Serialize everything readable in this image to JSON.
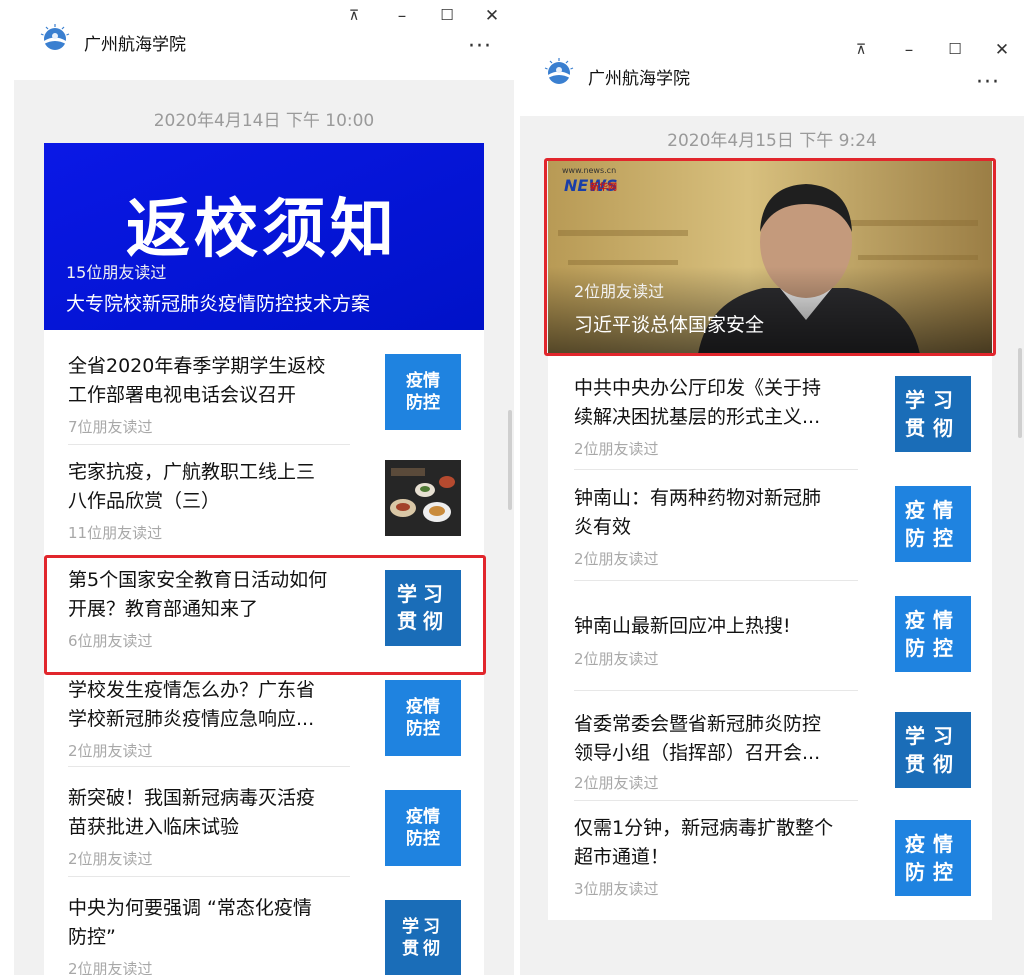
{
  "app": {
    "title": "广州航海学院",
    "pin_glyph": "⊼",
    "more_glyph": "···",
    "colors": {
      "badge_blue": "#1f83e0",
      "badge_dark": "#1a6db8",
      "highlight": "#e1262c",
      "chat_bg": "#f1f1f1"
    }
  },
  "left": {
    "timestamp": "2020年4月14日 下午 10:00",
    "cover": {
      "banner_text": "返校须知",
      "reads": "15位朋友读过",
      "title": "大专院校新冠肺炎疫情防控技术方案"
    },
    "items": [
      {
        "line1": "全省2020年春季学期学生返校",
        "line2": "工作部署电视电话会议召开",
        "reads": "7位朋友读过",
        "badge": [
          "疫情",
          "防控"
        ]
      },
      {
        "line1": "宅家抗疫，广航教职工线上三",
        "line2": "八作品欣赏（三）",
        "reads": "11位朋友读过"
      },
      {
        "line1": "第5个国家安全教育日活动如何",
        "line2": "开展？教育部通知来了",
        "reads": "6位朋友读过",
        "badge": [
          "学习",
          "贯彻"
        ]
      },
      {
        "line1": "学校发生疫情怎么办？广东省",
        "line2": "学校新冠肺炎疫情应急响应...",
        "reads": "2位朋友读过",
        "badge": [
          "疫情",
          "防控"
        ]
      },
      {
        "line1": "新突破！我国新冠病毒灭活疫",
        "line2": "苗获批进入临床试验",
        "reads": "2位朋友读过",
        "badge": [
          "疫情",
          "防控"
        ]
      },
      {
        "line1": "中央为何要强调 “常态化疫情",
        "line2": "防控”",
        "reads": "2位朋友读过",
        "badge": [
          "学习",
          "贯彻"
        ]
      }
    ]
  },
  "right": {
    "timestamp": "2020年4月15日 下午 9:24",
    "cover": {
      "news_site": "www.news.cn",
      "news_logo": "新华网",
      "news_word": "NEWS",
      "reads": "2位朋友读过",
      "title": "习近平谈总体国家安全"
    },
    "items": [
      {
        "line1": "中共中央办公厅印发《关于持",
        "line2": "续解决困扰基层的形式主义...",
        "reads": "2位朋友读过",
        "badge": [
          "学习",
          "贯彻"
        ]
      },
      {
        "line1": "钟南山：有两种药物对新冠肺",
        "line2": "炎有效",
        "reads": "2位朋友读过",
        "badge": [
          "疫情",
          "防控"
        ]
      },
      {
        "line1": "钟南山最新回应冲上热搜!",
        "line2": "",
        "reads": "2位朋友读过",
        "badge": [
          "疫情",
          "防控"
        ]
      },
      {
        "line1": "省委常委会暨省新冠肺炎防控",
        "line2": "领导小组（指挥部）召开会...",
        "reads": "2位朋友读过",
        "badge": [
          "学习",
          "贯彻"
        ]
      },
      {
        "line1": "仅需1分钟，新冠病毒扩散整个",
        "line2": "超市通道！",
        "reads": "3位朋友读过",
        "badge": [
          "疫情",
          "防控"
        ]
      }
    ]
  }
}
